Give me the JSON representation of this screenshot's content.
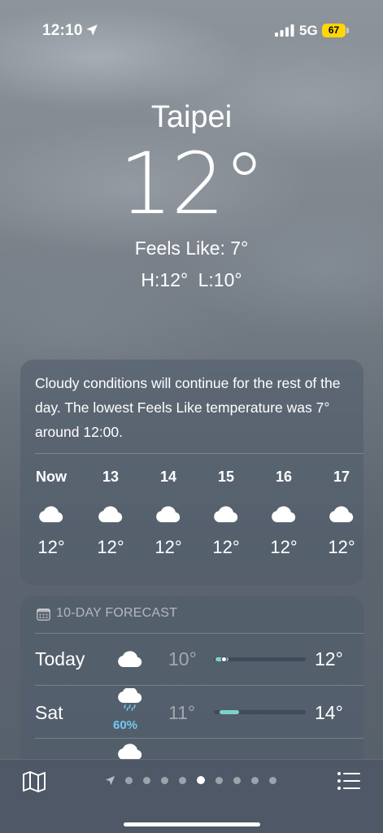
{
  "status_bar": {
    "time": "12:10",
    "network": "5G",
    "battery": "67",
    "battery_color": "#ffd60a",
    "icons": [
      "location-arrow-icon",
      "cellular-signal-icon",
      "battery-icon"
    ]
  },
  "location": {
    "city": "Taipei",
    "temperature": "12°",
    "feels_like": "Feels Like: 7°",
    "high_low": "H:12° L:10°"
  },
  "hourly": {
    "summary": "Cloudy conditions will continue for the rest of the day. The lowest Feels Like temperature was 7° around 12:00.",
    "hours": [
      {
        "label": "Now",
        "icon": "cloud-icon",
        "temp": "12°"
      },
      {
        "label": "13",
        "icon": "cloud-icon",
        "temp": "12°"
      },
      {
        "label": "14",
        "icon": "cloud-icon",
        "temp": "12°"
      },
      {
        "label": "15",
        "icon": "cloud-icon",
        "temp": "12°"
      },
      {
        "label": "16",
        "icon": "cloud-icon",
        "temp": "12°"
      },
      {
        "label": "17",
        "icon": "cloud-icon",
        "temp": "12°"
      }
    ]
  },
  "forecast": {
    "title": "10-DAY FORECAST",
    "icon": "calendar-icon",
    "days": [
      {
        "day": "Today",
        "icon": "cloud-icon",
        "precip": "",
        "low": "10°",
        "high": "12°",
        "current_temp_marker": true,
        "bar_color": "#7fd3c6"
      },
      {
        "day": "Sat",
        "icon": "cloud-rain-icon",
        "precip": "60%",
        "low": "11°",
        "high": "14°",
        "current_temp_marker": false,
        "bar_color": "#7fd3c6"
      }
    ],
    "precip_color": "#6fcbef"
  },
  "toolbar": {
    "left_icon": "map-icon",
    "right_icon": "list-icon",
    "page_count": 9,
    "active_page": 5
  }
}
